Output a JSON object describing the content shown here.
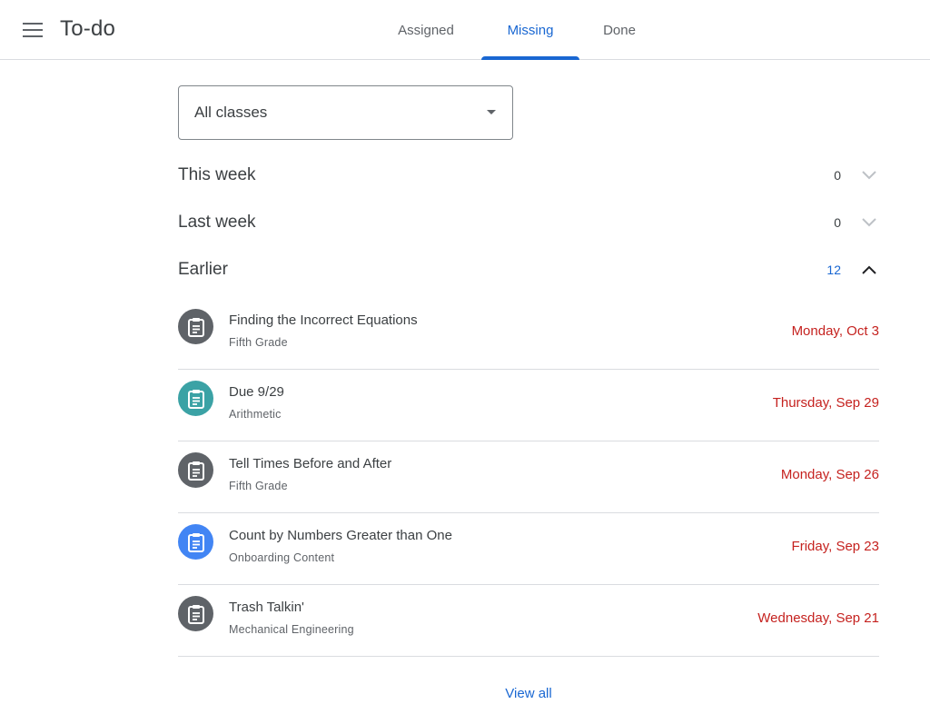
{
  "header": {
    "menu_icon": "hamburger-menu-icon",
    "title": "To-do"
  },
  "tabs": [
    {
      "label": "Assigned",
      "active": false
    },
    {
      "label": "Missing",
      "active": true
    },
    {
      "label": "Done",
      "active": false
    }
  ],
  "colors": {
    "accent": "#1967d2",
    "overdue": "#c5221f",
    "icon_gray": "#5f6368",
    "icon_teal": "#26a69a",
    "icon_blue": "#4285f4"
  },
  "class_filter": {
    "selected": "All classes",
    "icon": "dropdown-arrow-icon"
  },
  "sections": [
    {
      "title": "This week",
      "count": "0",
      "expanded": false
    },
    {
      "title": "Last week",
      "count": "0",
      "expanded": false
    },
    {
      "title": "Earlier",
      "count": "12",
      "expanded": true
    }
  ],
  "items": [
    {
      "title": "Finding the Incorrect Equations",
      "class": "Fifth Grade",
      "due": "Monday, Oct 3",
      "icon": "assignment-icon",
      "icon_color": "#5f6368"
    },
    {
      "title": "Due 9/29",
      "class": "Arithmetic",
      "due": "Thursday, Sep 29",
      "icon": "assignment-icon",
      "icon_color": "#3ba2a5"
    },
    {
      "title": "Tell Times Before and After",
      "class": "Fifth Grade",
      "due": "Monday, Sep 26",
      "icon": "assignment-icon",
      "icon_color": "#5f6368"
    },
    {
      "title": "Count by Numbers Greater than One",
      "class": "Onboarding Content",
      "due": "Friday, Sep 23",
      "icon": "assignment-icon",
      "icon_color": "#4285f4"
    },
    {
      "title": "Trash Talkin'",
      "class": "Mechanical Engineering",
      "due": "Wednesday, Sep 21",
      "icon": "assignment-icon",
      "icon_color": "#5f6368"
    }
  ],
  "footer": {
    "view_all_label": "View all"
  }
}
